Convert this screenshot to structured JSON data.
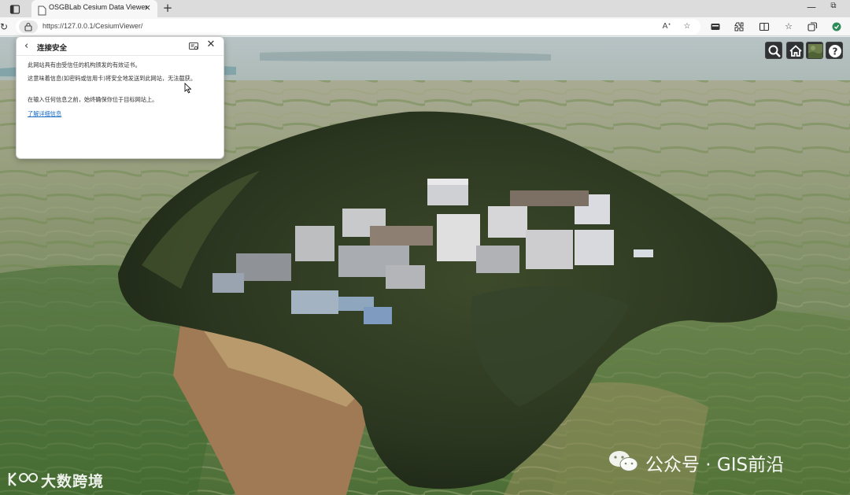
{
  "browser": {
    "tab": {
      "title": "OSGBLab Cesium Data Viewer",
      "close_glyph": "×"
    },
    "new_tab_glyph": "+",
    "window": {
      "minimize_glyph": "—",
      "maximize_glyph": "⧉"
    },
    "address": {
      "url": "https://127.0.0.1/CesiumViewer/"
    },
    "icons": [
      "sidebar-icon",
      "page-icon",
      "reload-icon",
      "lock-icon",
      "read-aloud-icon",
      "favorite-star-icon",
      "split-screen-icon",
      "extensions-icon",
      "reading-view-icon",
      "favorites-icon",
      "collections-icon",
      "copilot-icon"
    ]
  },
  "site_info_popup": {
    "back_glyph": "‹",
    "title": "连接安全",
    "close_glyph": "✕",
    "para1": "此网站具有由受信任的机构颁发的有效证书。",
    "para2": "这意味着信息(如密码或信用卡)将安全地发送到此网站，无法截获。",
    "para3": "在输入任何信息之前，始终确保你位于目标网站上。",
    "link": "了解详细信息"
  },
  "viewer_toolbar": [
    "search-icon",
    "home-icon",
    "base-layer-picker-icon",
    "help-icon"
  ],
  "watermarks": {
    "left": "大数跨境",
    "right": "公众号 · GIS前沿"
  },
  "colors": {
    "tabbar": "#dcdcdc",
    "toolbar": "#f7f7f7",
    "cesium_button": "#303336",
    "link": "#1a6dc7"
  }
}
